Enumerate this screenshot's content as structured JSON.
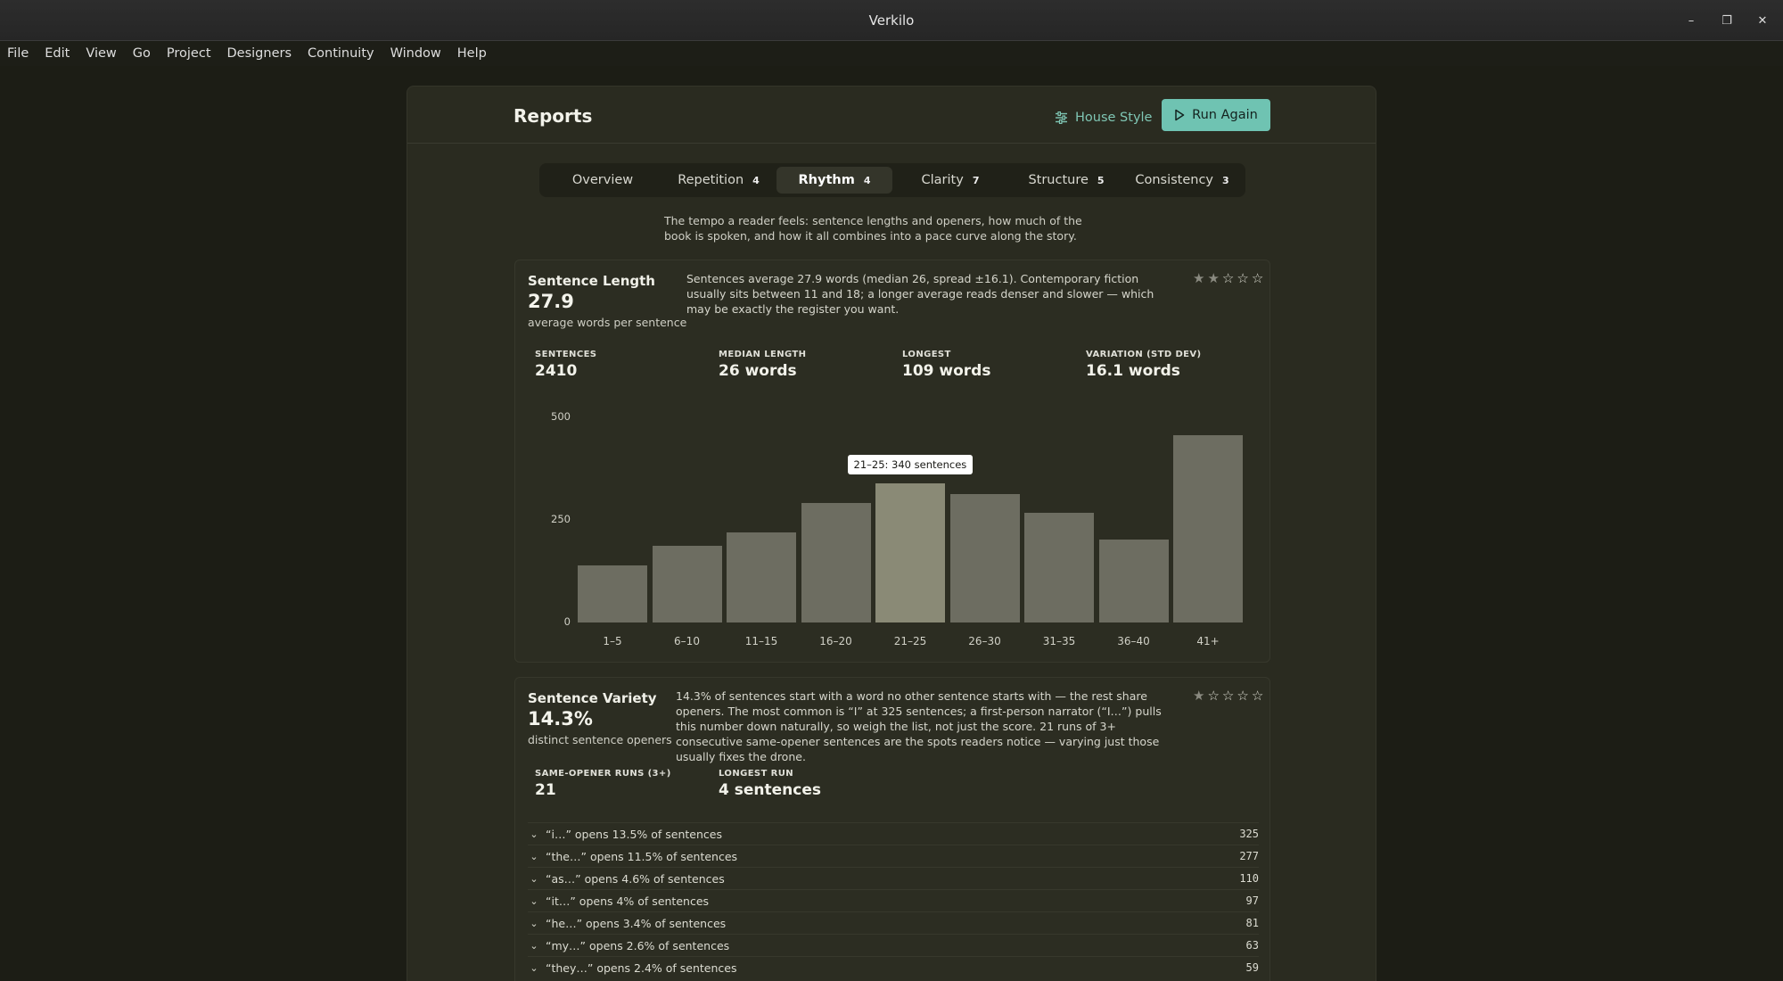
{
  "window": {
    "title": "Verkilo",
    "controls": [
      "–",
      "❐",
      "✕"
    ]
  },
  "menu": [
    "File",
    "Edit",
    "View",
    "Go",
    "Project",
    "Designers",
    "Continuity",
    "Window",
    "Help"
  ],
  "header": {
    "title": "Reports",
    "house_style_label": "House Style",
    "run_again_label": "Run Again",
    "accent_color": "#6fc3b2"
  },
  "tabs": [
    {
      "label": "Overview",
      "count": "",
      "active": false
    },
    {
      "label": "Repetition",
      "count": "4",
      "active": false
    },
    {
      "label": "Rhythm",
      "count": "4",
      "active": true
    },
    {
      "label": "Clarity",
      "count": "7",
      "active": false
    },
    {
      "label": "Structure",
      "count": "5",
      "active": false
    },
    {
      "label": "Consistency",
      "count": "3",
      "active": false
    }
  ],
  "intro": "The tempo a reader feels: sentence lengths and openers, how much of the book is spoken, and how it all combines into a pace curve along the story.",
  "sentence_length": {
    "title": "Sentence Length",
    "metric": "27.9",
    "metric_label": "average words per sentence",
    "description": "Sentences average 27.9 words (median 26, spread ±16.1). Contemporary fiction usually sits between 11 and 18; a longer average reads denser and slower — which may be exactly the register you want.",
    "rating": 2,
    "stats": [
      {
        "label": "SENTENCES",
        "value": "2410"
      },
      {
        "label": "MEDIAN LENGTH",
        "value": "26 words"
      },
      {
        "label": "LONGEST",
        "value": "109 words"
      },
      {
        "label": "VARIATION (STD DEV)",
        "value": "16.1 words"
      }
    ],
    "tooltip": "21–25: 340 sentences"
  },
  "chart_data": {
    "type": "bar",
    "categories": [
      "1–5",
      "6–10",
      "11–15",
      "16–20",
      "21–25",
      "26–30",
      "31–35",
      "36–40",
      "41+"
    ],
    "values": [
      140,
      188,
      219,
      291,
      340,
      312,
      268,
      202,
      457
    ],
    "yticks": [
      0,
      250,
      500
    ],
    "ylim": [
      0,
      500
    ],
    "highlight_index": 4,
    "bar_color": "#6d6d61",
    "highlight_color": "#8a8a76"
  },
  "sentence_variety": {
    "title": "Sentence Variety",
    "metric": "14.3%",
    "metric_label": "distinct sentence openers",
    "description": "14.3% of sentences start with a word no other sentence starts with — the rest share openers. The most common is “I” at 325 sentences; a first-person narrator (“I…”) pulls this number down naturally, so weigh the list, not just the score. 21 runs of 3+ consecutive same-opener sentences are the spots readers notice — varying just those usually fixes the drone.",
    "rating": 1,
    "stats": [
      {
        "label": "SAME-OPENER RUNS (3+)",
        "value": "21"
      },
      {
        "label": "LONGEST RUN",
        "value": "4 sentences"
      }
    ],
    "openers": [
      {
        "text": "“i…” opens 13.5% of sentences",
        "count": "325"
      },
      {
        "text": "“the…” opens 11.5% of sentences",
        "count": "277"
      },
      {
        "text": "“as…” opens 4.6% of sentences",
        "count": "110"
      },
      {
        "text": "“it…” opens 4% of sentences",
        "count": "97"
      },
      {
        "text": "“he…” opens 3.4% of sentences",
        "count": "81"
      },
      {
        "text": "“my…” opens 2.6% of sentences",
        "count": "63"
      },
      {
        "text": "“they…” opens 2.4% of sentences",
        "count": "59"
      }
    ]
  }
}
